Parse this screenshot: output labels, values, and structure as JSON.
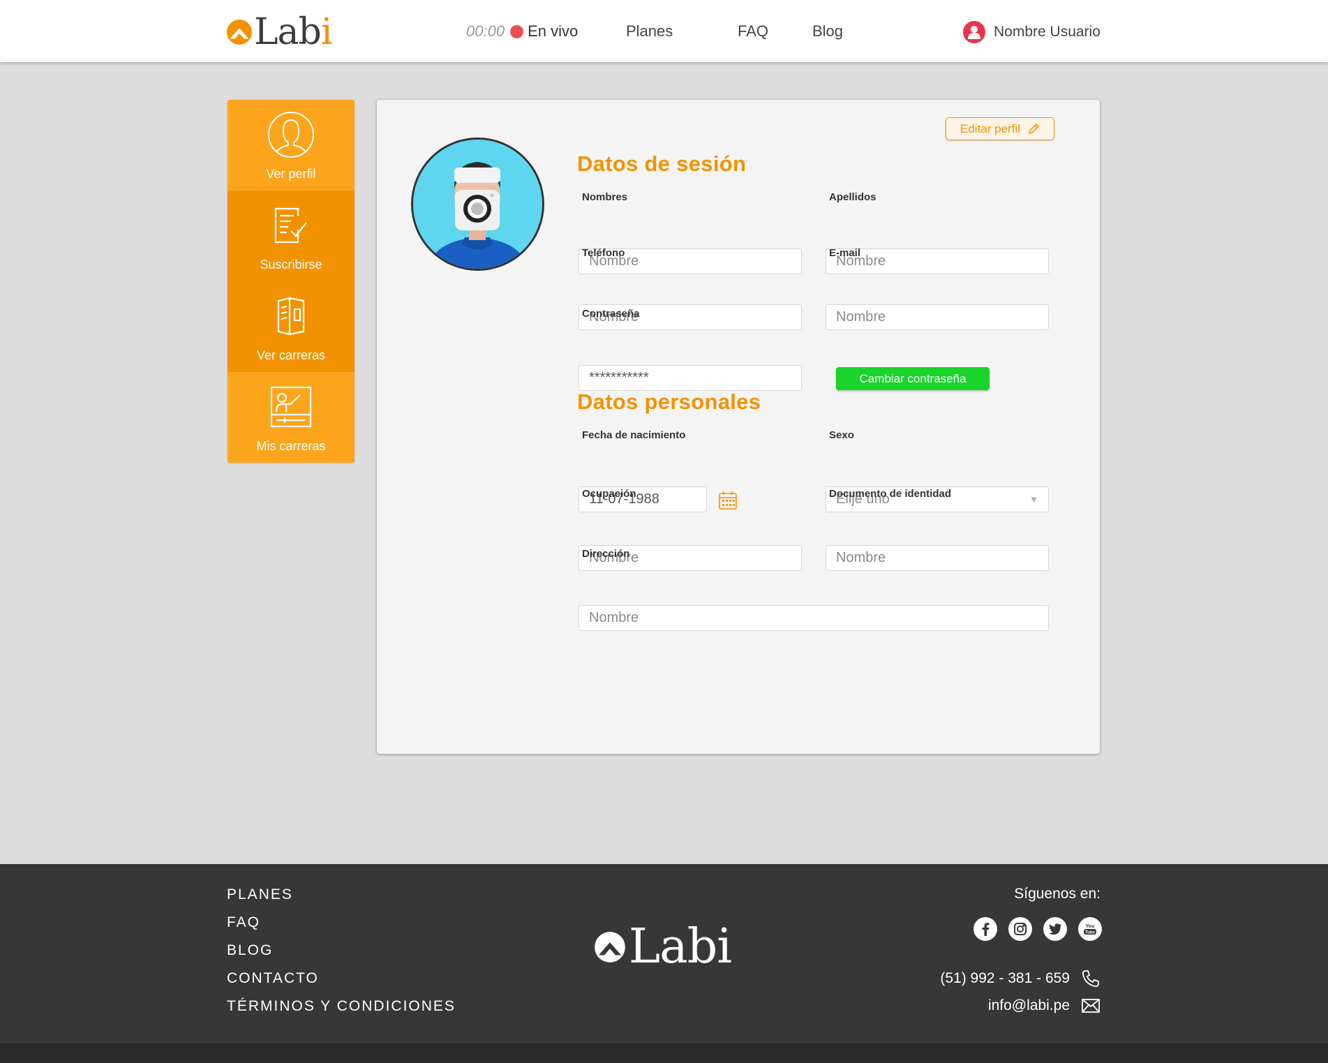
{
  "header": {
    "logo_text": "Labi",
    "live_time": "00:00",
    "live_label": "En vivo",
    "nav": [
      "Planes",
      "FAQ",
      "Blog"
    ],
    "user_name": "Nombre Usuario"
  },
  "sidebar": {
    "items": [
      {
        "label": "Ver perfil",
        "icon": "user-profile-icon"
      },
      {
        "label": "Suscribirse",
        "icon": "subscribe-form-icon"
      },
      {
        "label": "Ver carreras",
        "icon": "brochure-icon"
      },
      {
        "label": "Mis carreras",
        "icon": "classroom-board-icon"
      }
    ]
  },
  "profile": {
    "edit_label": "Editar perfil",
    "session": {
      "title": "Datos de sesión",
      "nombres_label": "Nombres",
      "nombres_placeholder": "Nombre",
      "apellidos_label": "Apellidos",
      "apellidos_placeholder": "Nombre",
      "telefono_label": "Teléfono",
      "telefono_placeholder": "Nombre",
      "email_label": "E-mail",
      "email_placeholder": "Nombre",
      "password_label": "Contraseña",
      "password_value": "***********",
      "change_password_label": "Cambiar contraseña"
    },
    "personal": {
      "title": "Datos personales",
      "birth_label": "Fecha de nacimiento",
      "birth_value": "11-07-1988",
      "sex_label": "Sexo",
      "sex_value": "Elije uno",
      "ocupacion_label": "Ocupación",
      "ocupacion_placeholder": "Nombre",
      "documento_label": "Documento de identidad",
      "documento_placeholder": "Nombre",
      "direccion_label": "Dirección",
      "direccion_placeholder": "Nombre"
    }
  },
  "footer": {
    "links": [
      "PLANES",
      "FAQ",
      "BLOG",
      "CONTACTO",
      "TÉRMINOS Y CONDICIONES"
    ],
    "logo_text": "Labi",
    "follow_label": "Síguenos en:",
    "socials": [
      "facebook-icon",
      "instagram-icon",
      "twitter-icon",
      "youtube-icon"
    ],
    "youtube_text": "You Tube",
    "phone": "(51) 992 - 381 - 659",
    "email": "info@labi.pe"
  },
  "colors": {
    "accent": "#f39200",
    "accent_light": "#fca51c",
    "live_dot": "#f04e4e",
    "success": "#19d42a",
    "footer_bg": "#373737",
    "page_bg": "#dddddd"
  }
}
